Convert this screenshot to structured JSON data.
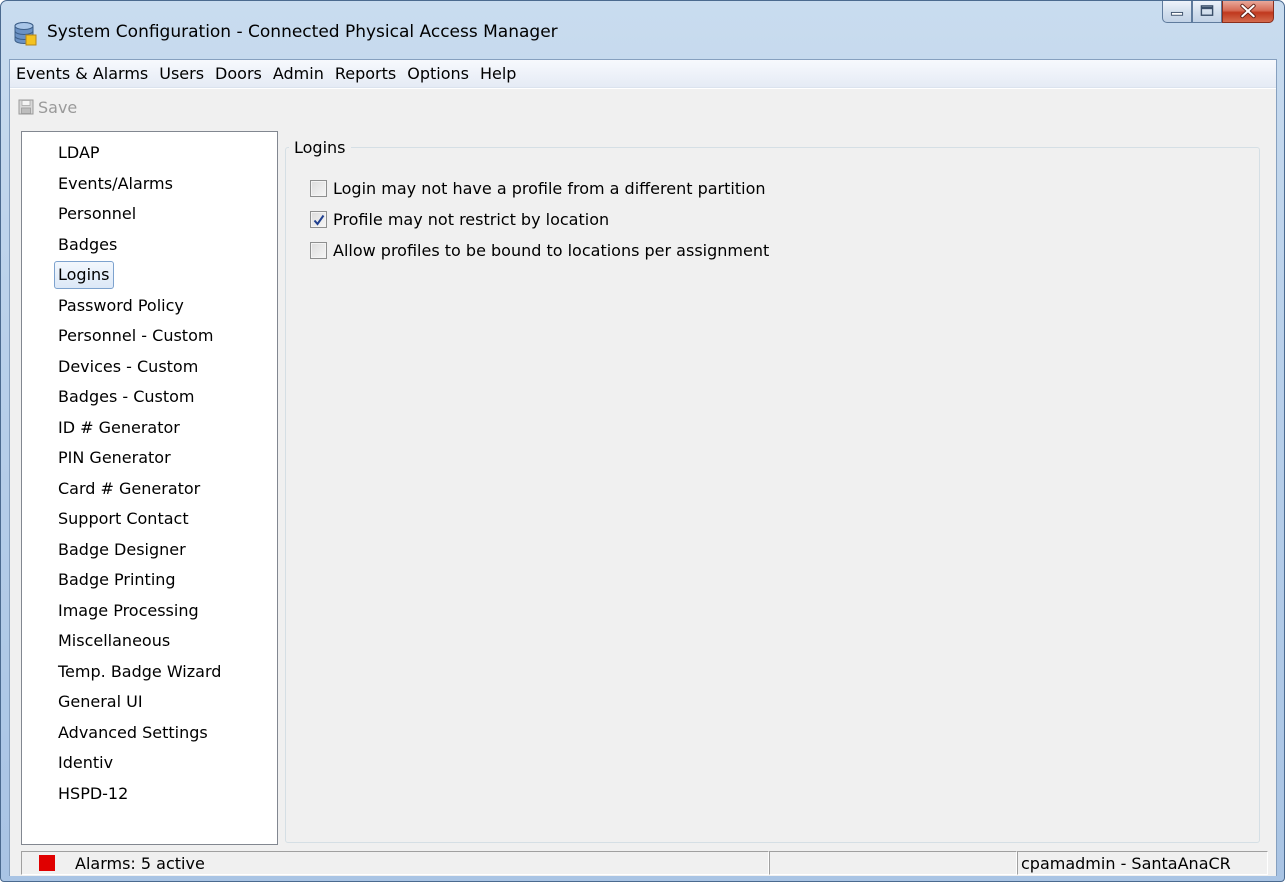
{
  "window": {
    "title": "System Configuration - Connected Physical Access Manager",
    "app_icon": "database-icon"
  },
  "caption_buttons": [
    "minimize-icon",
    "maximize-icon",
    "close-icon"
  ],
  "menu": {
    "items": [
      "Events & Alarms",
      "Users",
      "Doors",
      "Admin",
      "Reports",
      "Options",
      "Help"
    ]
  },
  "toolbar": {
    "save_label": "Save",
    "save_icon": "floppy-disk-icon",
    "save_enabled": false
  },
  "sidebar": {
    "selected": "Logins",
    "items": [
      "LDAP",
      "Events/Alarms",
      "Personnel",
      "Badges",
      "Logins",
      "Password Policy",
      "Personnel - Custom",
      "Devices - Custom",
      "Badges - Custom",
      "ID # Generator",
      "PIN Generator",
      "Card # Generator",
      "Support Contact",
      "Badge Designer",
      "Badge Printing",
      "Image Processing",
      "Miscellaneous",
      "Temp. Badge Wizard",
      "General UI",
      "Advanced Settings",
      "Identiv",
      "HSPD-12"
    ]
  },
  "logins_panel": {
    "group_title": "Logins",
    "options": [
      {
        "label": "Login may not have a profile from a different partition",
        "checked": false
      },
      {
        "label": "Profile may not restrict by location",
        "checked": true
      },
      {
        "label": "Allow profiles to be bound to locations per assignment",
        "checked": false
      }
    ]
  },
  "status": {
    "alarm_color": "#e00000",
    "alarms_text": "Alarms: 5 active",
    "middle_text": "",
    "user_text": "cpamadmin - SantaAnaCR"
  }
}
